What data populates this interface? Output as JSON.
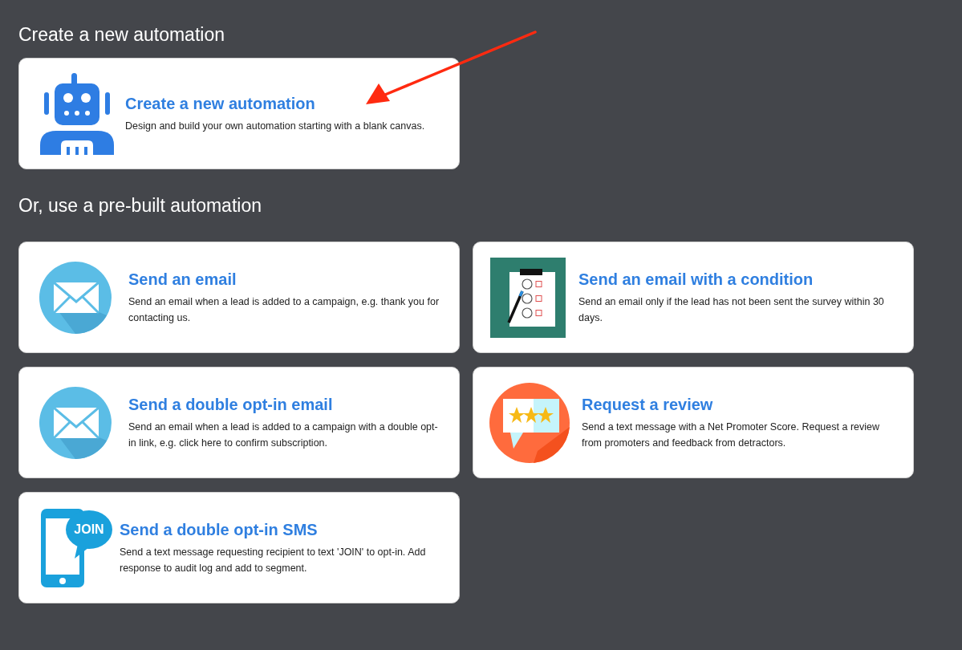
{
  "heading": "Create a new automation",
  "new_card": {
    "kind": "robot",
    "title": "Create a new automation",
    "description": "Design and build your own automation starting with a blank canvas."
  },
  "prebuilt_heading": "Or, use a pre-built automation",
  "templates": [
    {
      "kind": "email",
      "title": "Send an email",
      "description": "Send an email when a lead is added to a campaign, e.g. thank you for contacting us."
    },
    {
      "kind": "checklist",
      "title": "Send an email with a condition",
      "description": "Send an email only if the lead has not been sent the survey within 30 days."
    },
    {
      "kind": "email",
      "title": "Send a double opt-in email",
      "description": "Send an email when a lead is added to a campaign with a double opt-in link, e.g. click here to confirm subscription."
    },
    {
      "kind": "review",
      "title": "Request a review",
      "description": "Send a text message with a Net Promoter Score. Request a review from promoters and feedback from detractors."
    },
    {
      "kind": "sms",
      "title": "Send a double opt-in SMS",
      "description": "Send a text message requesting recipient to text 'JOIN' to opt-in. Add response to audit log and add to segment.",
      "icon_text": "JOIN"
    }
  ]
}
